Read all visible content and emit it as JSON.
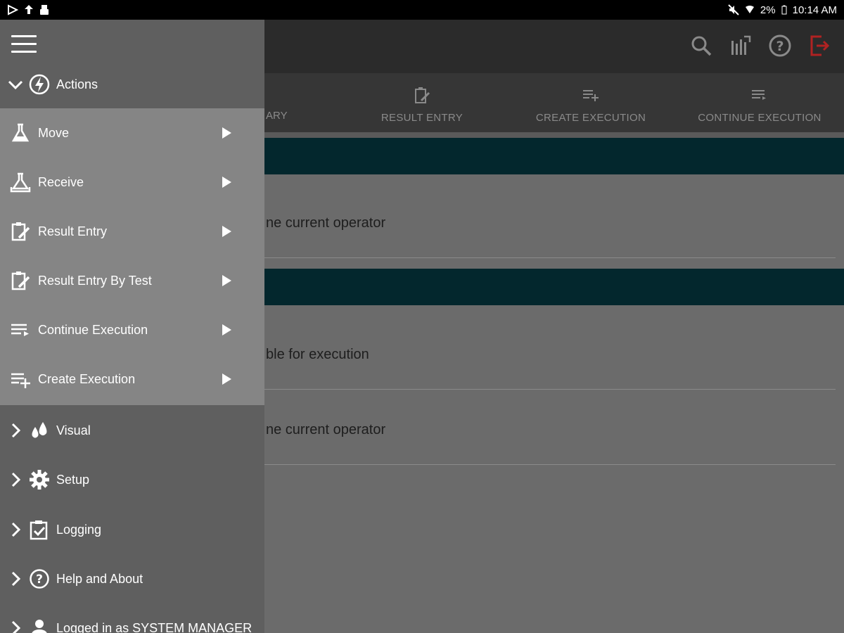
{
  "status_bar": {
    "battery": "2%",
    "time": "10:14 AM"
  },
  "colors": {
    "logout_accent": "#d32f2f",
    "section_bar": "#03272d",
    "drawer_bg": "#5f5f5f",
    "submenu_bg": "#858585"
  },
  "app": {
    "header_icons": [
      "search-icon",
      "chart-icon",
      "help-icon",
      "logout-icon"
    ],
    "tabs": {
      "partial": "ARY",
      "result_entry": "RESULT ENTRY",
      "create_execution": "CREATE EXECUTION",
      "continue_execution": "CONTINUE EXECUTION"
    },
    "cards": {
      "card1": "ne current operator",
      "card2": "ble for execution",
      "card3": "ne current operator"
    }
  },
  "drawer": {
    "actions_label": "Actions",
    "sub_items": [
      {
        "label": "Move",
        "icon": "flask-move-icon"
      },
      {
        "label": "Receive",
        "icon": "flask-receive-icon"
      },
      {
        "label": "Result Entry",
        "icon": "clipboard-edit-icon"
      },
      {
        "label": "Result Entry By Test",
        "icon": "clipboard-edit-icon"
      },
      {
        "label": "Continue Execution",
        "icon": "list-arrow-icon"
      },
      {
        "label": "Create Execution",
        "icon": "list-add-icon"
      }
    ],
    "nav_items": [
      {
        "label": "Visual",
        "icon": "drops-icon"
      },
      {
        "label": "Setup",
        "icon": "gear-icon"
      },
      {
        "label": "Logging",
        "icon": "checklist-icon"
      },
      {
        "label": "Help and About",
        "icon": "help-icon"
      },
      {
        "label": "Logged in as SYSTEM MANAGER",
        "icon": "user-icon"
      }
    ]
  }
}
